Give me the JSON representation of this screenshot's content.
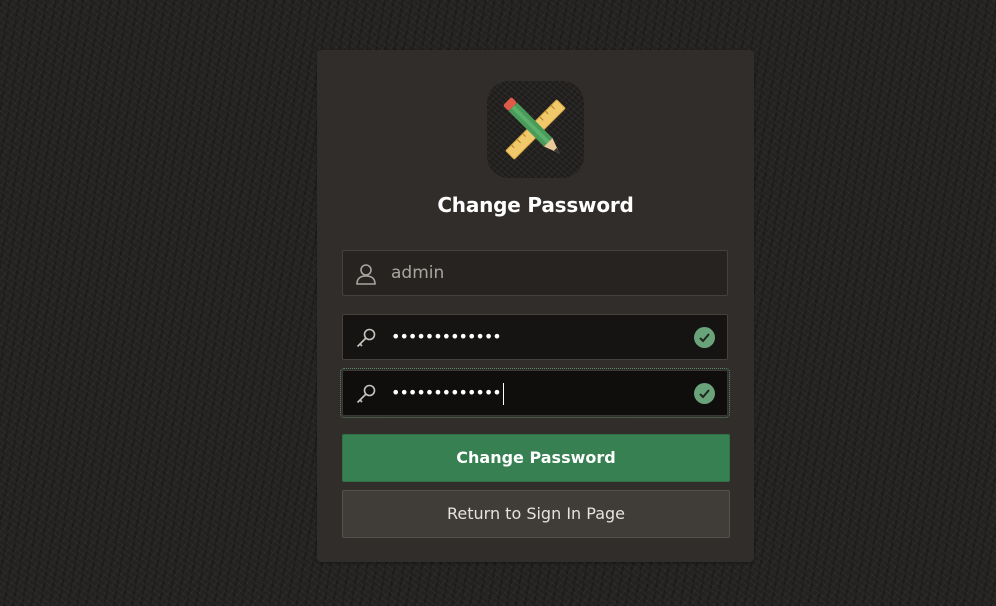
{
  "card": {
    "title": "Change Password"
  },
  "fields": {
    "username": {
      "value": "admin",
      "icon": "user-icon"
    },
    "new_password": {
      "masked_value": "•••••••••••••",
      "icon": "key-icon",
      "status_icon": "check-circle-icon"
    },
    "confirm_password": {
      "masked_value": "•••••••••••••",
      "icon": "key-icon",
      "status_icon": "check-circle-icon"
    }
  },
  "buttons": {
    "change_password": "Change Password",
    "return_sign_in": "Return to Sign In Page"
  },
  "colors": {
    "primary_button": "#368052",
    "valid_check": "#6aa37a",
    "card_bg": "#312d2a"
  }
}
